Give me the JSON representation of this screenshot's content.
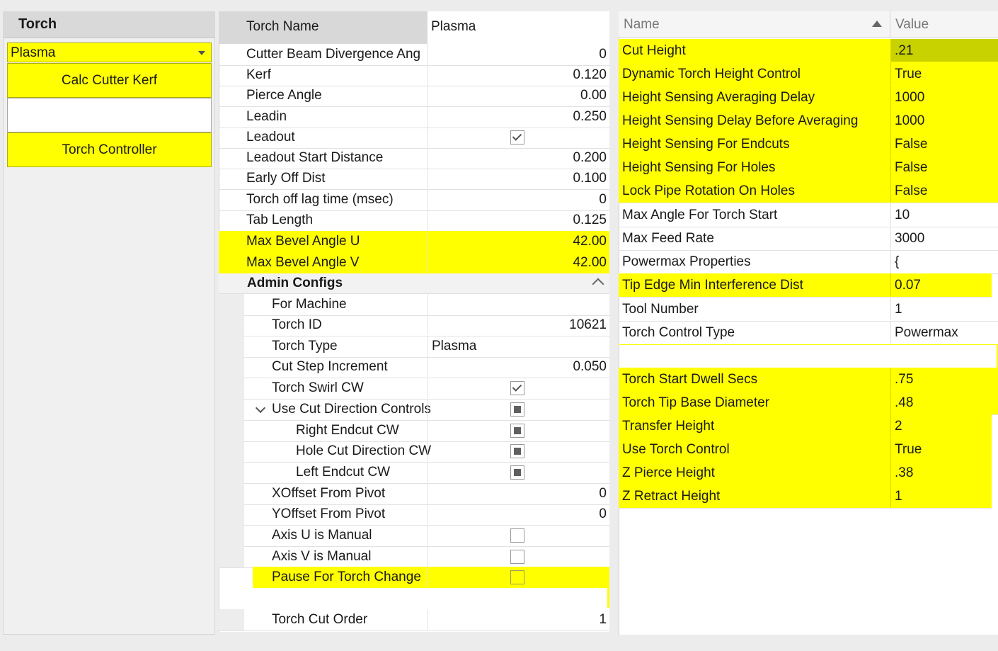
{
  "left": {
    "header": "Torch",
    "selected_torch": "Plasma",
    "calc_button": "Calc Cutter Kerf",
    "controller_button": "Torch Controller"
  },
  "middle": {
    "torch_name_label": "Torch Name",
    "torch_name_value": "Plasma",
    "rows": [
      {
        "label": "Cutter Beam Divergence Ang",
        "value": "0"
      },
      {
        "label": "Kerf",
        "value": "0.120"
      },
      {
        "label": "Pierce Angle",
        "value": "0.00"
      },
      {
        "label": "Leadin",
        "value": "0.250"
      },
      {
        "label": "Leadout",
        "value": ""
      },
      {
        "label": "Leadout Start Distance",
        "value": "0.200"
      },
      {
        "label": "Early Off Dist",
        "value": "0.100"
      },
      {
        "label": "Torch off lag time (msec)",
        "value": "0"
      },
      {
        "label": "Tab Length",
        "value": "0.125"
      },
      {
        "label": "Max Bevel Angle U",
        "value": "42.00"
      },
      {
        "label": "Max Bevel Angle V",
        "value": "42.00"
      }
    ],
    "admin_header": "Admin Configs",
    "admin_rows": [
      {
        "label": "For Machine",
        "value": ""
      },
      {
        "label": "Torch ID",
        "value": "10621"
      },
      {
        "label": "Torch Type",
        "value": "Plasma"
      },
      {
        "label": "Cut Step Increment",
        "value": "0.050"
      },
      {
        "label": "Torch Swirl CW",
        "value": ""
      },
      {
        "label": "Use Cut Direction Controls",
        "value": ""
      },
      {
        "label": "Right Endcut CW",
        "value": ""
      },
      {
        "label": "Hole Cut Direction CW",
        "value": ""
      },
      {
        "label": "Left Endcut CW",
        "value": ""
      },
      {
        "label": "XOffset From Pivot",
        "value": "0"
      },
      {
        "label": "YOffset From Pivot",
        "value": "0"
      },
      {
        "label": "Axis U is Manual",
        "value": ""
      },
      {
        "label": "Axis V is Manual",
        "value": ""
      },
      {
        "label": "Pause For Torch Change",
        "value": ""
      },
      {
        "label": "Torch Cut Order",
        "value": "1"
      }
    ],
    "checkbox_states": {
      "leadout": "checked",
      "torch_swirl_cw": "checked",
      "use_cut_direction_controls": "indeterminate",
      "right_endcut_cw": "indeterminate",
      "hole_cut_direction_cw": "indeterminate",
      "left_endcut_cw": "indeterminate",
      "axis_u_is_manual": "unchecked",
      "axis_v_is_manual": "unchecked",
      "pause_for_torch_change": "unchecked"
    }
  },
  "right": {
    "col_name": "Name",
    "col_value": "Value",
    "rows": [
      {
        "name": "Cut Height",
        "value": ".21"
      },
      {
        "name": "Dynamic Torch Height Control",
        "value": "True"
      },
      {
        "name": "Height Sensing Averaging Delay",
        "value": "1000"
      },
      {
        "name": "Height Sensing Delay Before Averaging",
        "value": "1000"
      },
      {
        "name": "Height Sensing For Endcuts",
        "value": "False"
      },
      {
        "name": "Height Sensing For Holes",
        "value": "False"
      },
      {
        "name": "Lock Pipe Rotation On Holes",
        "value": "False"
      },
      {
        "name": "Max Angle For Torch Start",
        "value": "10"
      },
      {
        "name": "Max Feed Rate",
        "value": "3000"
      },
      {
        "name": "Powermax Properties",
        "value": "{"
      },
      {
        "name": "Tip Edge Min Interference Dist",
        "value": "0.07"
      },
      {
        "name": "Tool Number",
        "value": "1"
      },
      {
        "name": "Torch Control Type",
        "value": "Powermax"
      },
      {
        "name": "",
        "value": ""
      },
      {
        "name": "Torch Start Dwell Secs",
        "value": ".75"
      },
      {
        "name": "Torch Tip Base Diameter",
        "value": ".48"
      },
      {
        "name": "Transfer Height",
        "value": "2"
      },
      {
        "name": "Use Torch Control",
        "value": "True"
      },
      {
        "name": "Z Pierce Height",
        "value": ".38"
      },
      {
        "name": "Z Retract Height",
        "value": "1"
      }
    ]
  },
  "colors": {
    "highlight": "#ffff00",
    "selected_value": "#c8d200"
  }
}
